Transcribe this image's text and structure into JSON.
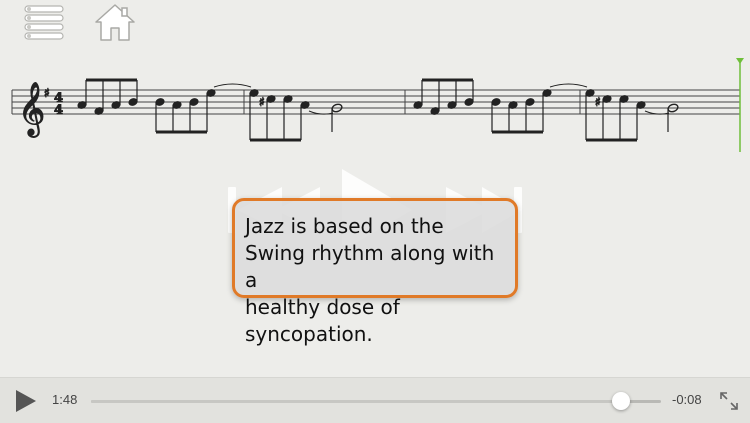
{
  "toolbar": {
    "menu_icon": "list-menu-icon",
    "home_icon": "home-icon"
  },
  "score": {
    "clef": "treble-clef",
    "key_signature": "F#",
    "time_signature_top": "4",
    "time_signature_bottom": "4",
    "playhead_color": "#6fbf3a"
  },
  "transport_overlay": {
    "icons": [
      "rewind-icon",
      "play-icon",
      "fast-forward-icon"
    ]
  },
  "tooltip": {
    "line1": "Jazz is based on the",
    "line2": "Swing rhythm along with a",
    "line3": "healthy dose of syncopation.",
    "border_color": "#e07a28"
  },
  "player": {
    "elapsed": "1:48",
    "remaining": "-0:08",
    "progress": 0.93,
    "play_icon": "play-icon",
    "fullscreen_icon": "expand-icon"
  }
}
